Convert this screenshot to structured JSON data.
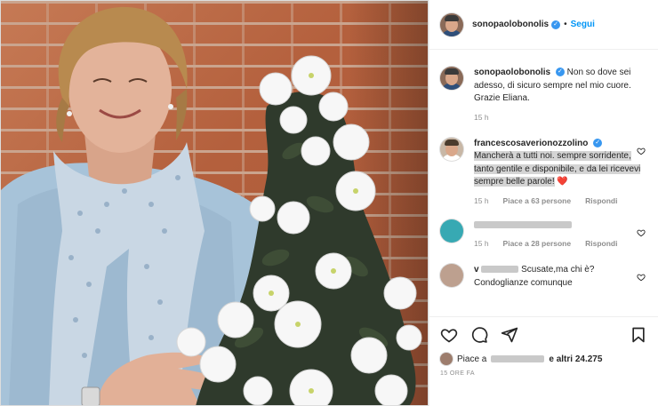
{
  "header": {
    "username": "sonopaolobonolis",
    "verified_mark": "✓",
    "separator": "•",
    "follow_label": "Segui"
  },
  "comments": [
    {
      "username": "sonopaolobonolis",
      "verified_mark": "✓",
      "text": "Non so dove sei adesso, di sicuro sempre nel mio cuore. Grazie Eliana.",
      "time": "15 h"
    },
    {
      "username": "francescosaverionozzolino",
      "verified_mark": "✓",
      "text": "Mancherà a tutti noi. sempre sorridente, tanto gentile e disponibile, e da lei ricevevi sempre belle parole!",
      "emoji": "❤️",
      "time": "15 h",
      "likes": "Piace a 63 persone",
      "reply": "Rispondi"
    },
    {
      "username_partial": "",
      "time": "15 h",
      "likes": "Piace a 28 persone",
      "reply": "Rispondi"
    },
    {
      "username_partial": "v",
      "text": "Scusate,ma chi è?",
      "text2": "Condoglianze comunque"
    }
  ],
  "likes_bar": {
    "prefix": "Piace a",
    "suffix": "e altri 24.275",
    "time": "15 ORE FA"
  },
  "icons": [
    "heart-icon",
    "comment-icon",
    "share-icon",
    "bookmark-icon"
  ],
  "colors": {
    "accent": "#0095f6",
    "verified": "#3897f0",
    "heart": "#ed4956"
  }
}
